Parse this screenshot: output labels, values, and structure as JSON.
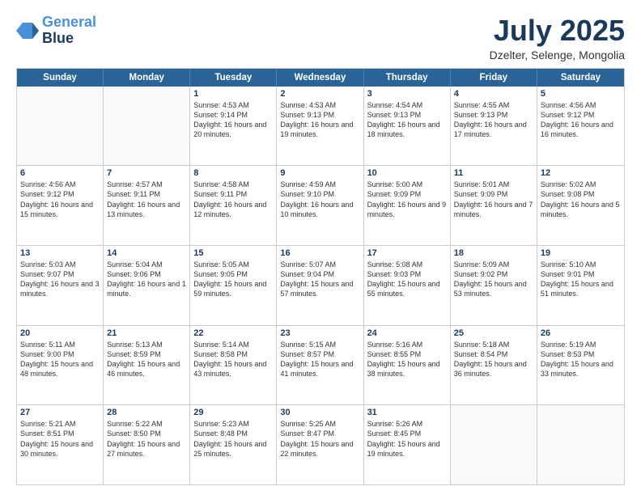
{
  "header": {
    "logo_line1": "General",
    "logo_line2": "Blue",
    "month": "July 2025",
    "location": "Dzelter, Selenge, Mongolia"
  },
  "weekdays": [
    "Sunday",
    "Monday",
    "Tuesday",
    "Wednesday",
    "Thursday",
    "Friday",
    "Saturday"
  ],
  "weeks": [
    [
      {
        "day": "",
        "sunrise": "",
        "sunset": "",
        "daylight": ""
      },
      {
        "day": "",
        "sunrise": "",
        "sunset": "",
        "daylight": ""
      },
      {
        "day": "1",
        "sunrise": "Sunrise: 4:53 AM",
        "sunset": "Sunset: 9:14 PM",
        "daylight": "Daylight: 16 hours and 20 minutes."
      },
      {
        "day": "2",
        "sunrise": "Sunrise: 4:53 AM",
        "sunset": "Sunset: 9:13 PM",
        "daylight": "Daylight: 16 hours and 19 minutes."
      },
      {
        "day": "3",
        "sunrise": "Sunrise: 4:54 AM",
        "sunset": "Sunset: 9:13 PM",
        "daylight": "Daylight: 16 hours and 18 minutes."
      },
      {
        "day": "4",
        "sunrise": "Sunrise: 4:55 AM",
        "sunset": "Sunset: 9:13 PM",
        "daylight": "Daylight: 16 hours and 17 minutes."
      },
      {
        "day": "5",
        "sunrise": "Sunrise: 4:56 AM",
        "sunset": "Sunset: 9:12 PM",
        "daylight": "Daylight: 16 hours and 16 minutes."
      }
    ],
    [
      {
        "day": "6",
        "sunrise": "Sunrise: 4:56 AM",
        "sunset": "Sunset: 9:12 PM",
        "daylight": "Daylight: 16 hours and 15 minutes."
      },
      {
        "day": "7",
        "sunrise": "Sunrise: 4:57 AM",
        "sunset": "Sunset: 9:11 PM",
        "daylight": "Daylight: 16 hours and 13 minutes."
      },
      {
        "day": "8",
        "sunrise": "Sunrise: 4:58 AM",
        "sunset": "Sunset: 9:11 PM",
        "daylight": "Daylight: 16 hours and 12 minutes."
      },
      {
        "day": "9",
        "sunrise": "Sunrise: 4:59 AM",
        "sunset": "Sunset: 9:10 PM",
        "daylight": "Daylight: 16 hours and 10 minutes."
      },
      {
        "day": "10",
        "sunrise": "Sunrise: 5:00 AM",
        "sunset": "Sunset: 9:09 PM",
        "daylight": "Daylight: 16 hours and 9 minutes."
      },
      {
        "day": "11",
        "sunrise": "Sunrise: 5:01 AM",
        "sunset": "Sunset: 9:09 PM",
        "daylight": "Daylight: 16 hours and 7 minutes."
      },
      {
        "day": "12",
        "sunrise": "Sunrise: 5:02 AM",
        "sunset": "Sunset: 9:08 PM",
        "daylight": "Daylight: 16 hours and 5 minutes."
      }
    ],
    [
      {
        "day": "13",
        "sunrise": "Sunrise: 5:03 AM",
        "sunset": "Sunset: 9:07 PM",
        "daylight": "Daylight: 16 hours and 3 minutes."
      },
      {
        "day": "14",
        "sunrise": "Sunrise: 5:04 AM",
        "sunset": "Sunset: 9:06 PM",
        "daylight": "Daylight: 16 hours and 1 minute."
      },
      {
        "day": "15",
        "sunrise": "Sunrise: 5:05 AM",
        "sunset": "Sunset: 9:05 PM",
        "daylight": "Daylight: 15 hours and 59 minutes."
      },
      {
        "day": "16",
        "sunrise": "Sunrise: 5:07 AM",
        "sunset": "Sunset: 9:04 PM",
        "daylight": "Daylight: 15 hours and 57 minutes."
      },
      {
        "day": "17",
        "sunrise": "Sunrise: 5:08 AM",
        "sunset": "Sunset: 9:03 PM",
        "daylight": "Daylight: 15 hours and 55 minutes."
      },
      {
        "day": "18",
        "sunrise": "Sunrise: 5:09 AM",
        "sunset": "Sunset: 9:02 PM",
        "daylight": "Daylight: 15 hours and 53 minutes."
      },
      {
        "day": "19",
        "sunrise": "Sunrise: 5:10 AM",
        "sunset": "Sunset: 9:01 PM",
        "daylight": "Daylight: 15 hours and 51 minutes."
      }
    ],
    [
      {
        "day": "20",
        "sunrise": "Sunrise: 5:11 AM",
        "sunset": "Sunset: 9:00 PM",
        "daylight": "Daylight: 15 hours and 48 minutes."
      },
      {
        "day": "21",
        "sunrise": "Sunrise: 5:13 AM",
        "sunset": "Sunset: 8:59 PM",
        "daylight": "Daylight: 15 hours and 46 minutes."
      },
      {
        "day": "22",
        "sunrise": "Sunrise: 5:14 AM",
        "sunset": "Sunset: 8:58 PM",
        "daylight": "Daylight: 15 hours and 43 minutes."
      },
      {
        "day": "23",
        "sunrise": "Sunrise: 5:15 AM",
        "sunset": "Sunset: 8:57 PM",
        "daylight": "Daylight: 15 hours and 41 minutes."
      },
      {
        "day": "24",
        "sunrise": "Sunrise: 5:16 AM",
        "sunset": "Sunset: 8:55 PM",
        "daylight": "Daylight: 15 hours and 38 minutes."
      },
      {
        "day": "25",
        "sunrise": "Sunrise: 5:18 AM",
        "sunset": "Sunset: 8:54 PM",
        "daylight": "Daylight: 15 hours and 36 minutes."
      },
      {
        "day": "26",
        "sunrise": "Sunrise: 5:19 AM",
        "sunset": "Sunset: 8:53 PM",
        "daylight": "Daylight: 15 hours and 33 minutes."
      }
    ],
    [
      {
        "day": "27",
        "sunrise": "Sunrise: 5:21 AM",
        "sunset": "Sunset: 8:51 PM",
        "daylight": "Daylight: 15 hours and 30 minutes."
      },
      {
        "day": "28",
        "sunrise": "Sunrise: 5:22 AM",
        "sunset": "Sunset: 8:50 PM",
        "daylight": "Daylight: 15 hours and 27 minutes."
      },
      {
        "day": "29",
        "sunrise": "Sunrise: 5:23 AM",
        "sunset": "Sunset: 8:48 PM",
        "daylight": "Daylight: 15 hours and 25 minutes."
      },
      {
        "day": "30",
        "sunrise": "Sunrise: 5:25 AM",
        "sunset": "Sunset: 8:47 PM",
        "daylight": "Daylight: 15 hours and 22 minutes."
      },
      {
        "day": "31",
        "sunrise": "Sunrise: 5:26 AM",
        "sunset": "Sunset: 8:45 PM",
        "daylight": "Daylight: 15 hours and 19 minutes."
      },
      {
        "day": "",
        "sunrise": "",
        "sunset": "",
        "daylight": ""
      },
      {
        "day": "",
        "sunrise": "",
        "sunset": "",
        "daylight": ""
      }
    ]
  ]
}
